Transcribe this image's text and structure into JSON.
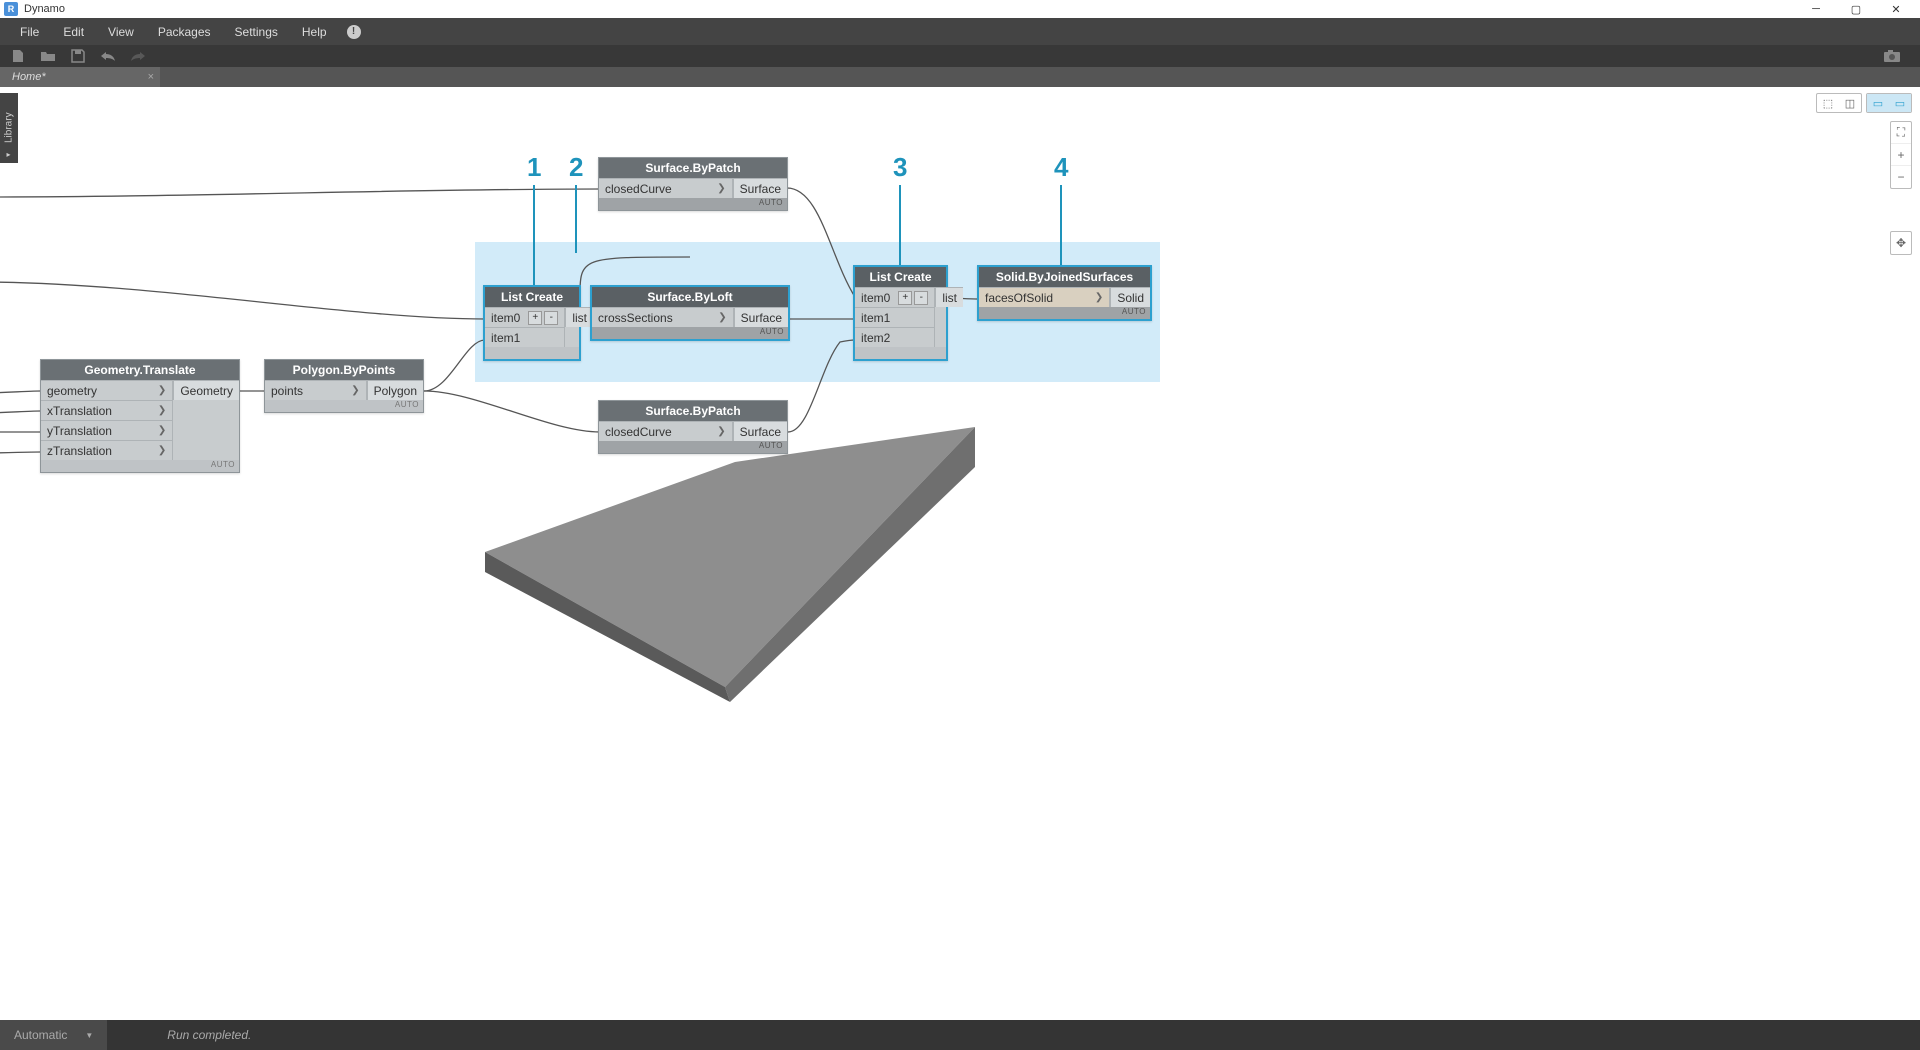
{
  "window": {
    "title": "Dynamo"
  },
  "menu": {
    "file": "File",
    "edit": "Edit",
    "view": "View",
    "packages": "Packages",
    "settings": "Settings",
    "help": "Help"
  },
  "tabs": {
    "home": "Home*"
  },
  "library": {
    "label": "Library"
  },
  "status": {
    "mode": "Automatic",
    "msg": "Run completed."
  },
  "footer": {
    "auto": "AUTO"
  },
  "callouts": {
    "c1": "1",
    "c2": "2",
    "c3": "3",
    "c4": "4"
  },
  "nodes": {
    "geotrans": {
      "title": "Geometry.Translate",
      "in": [
        "geometry",
        "xTranslation",
        "yTranslation",
        "zTranslation"
      ],
      "out": "Geometry"
    },
    "polypts": {
      "title": "Polygon.ByPoints",
      "in": [
        "points"
      ],
      "out": "Polygon"
    },
    "surfpatch1": {
      "title": "Surface.ByPatch",
      "in": [
        "closedCurve"
      ],
      "out": "Surface"
    },
    "surfpatch2": {
      "title": "Surface.ByPatch",
      "in": [
        "closedCurve"
      ],
      "out": "Surface"
    },
    "list1": {
      "title": "List Create",
      "items": [
        "item0",
        "item1"
      ],
      "plus": "+",
      "minus": "-",
      "out": "list"
    },
    "surfloft": {
      "title": "Surface.ByLoft",
      "in": [
        "crossSections"
      ],
      "out": "Surface"
    },
    "list2": {
      "title": "List Create",
      "items": [
        "item0",
        "item1",
        "item2"
      ],
      "plus": "+",
      "minus": "-",
      "out": "list"
    },
    "solidjoin": {
      "title": "Solid.ByJoinedSurfaces",
      "in": [
        "facesOfSolid"
      ],
      "out": "Solid"
    }
  }
}
